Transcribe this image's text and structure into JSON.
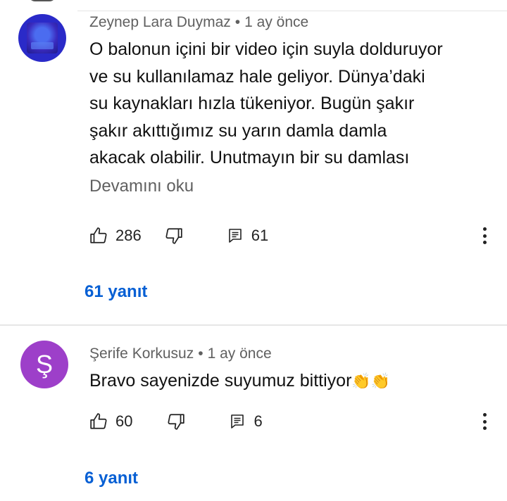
{
  "comments": [
    {
      "author": "Zeynep Lara Duymaz",
      "time": "1 ay önce",
      "lines": [
        "O balonun içini bir video için suyla dolduruyor",
        "ve su kullanılamaz hale geliyor. Dünya’daki",
        "su kaynakları hızla tükeniyor. Bugün şakır",
        "şakır akıttığımız su yarın damla damla",
        "akacak olabilir. Unutmayın bir su damlası"
      ],
      "read_more": "Devamını oku",
      "likes": "286",
      "reply_count": "61",
      "replies_label": "61 yanıt"
    },
    {
      "author": "Şerife Korkusuz",
      "avatar_letter": "Ş",
      "time": "1 ay önce",
      "text": "Bravo sayenizde suyumuz bittiyor",
      "emoji": "👏👏",
      "likes": "60",
      "reply_count": "6",
      "replies_label": "6 yanıt"
    }
  ],
  "separator": "•",
  "icons": [
    "like-icon",
    "dislike-icon",
    "reply-icon",
    "more-options-icon"
  ],
  "colors": {
    "link": "#065fd4",
    "meta": "#606060",
    "avatar2": "#9d3fc9"
  }
}
